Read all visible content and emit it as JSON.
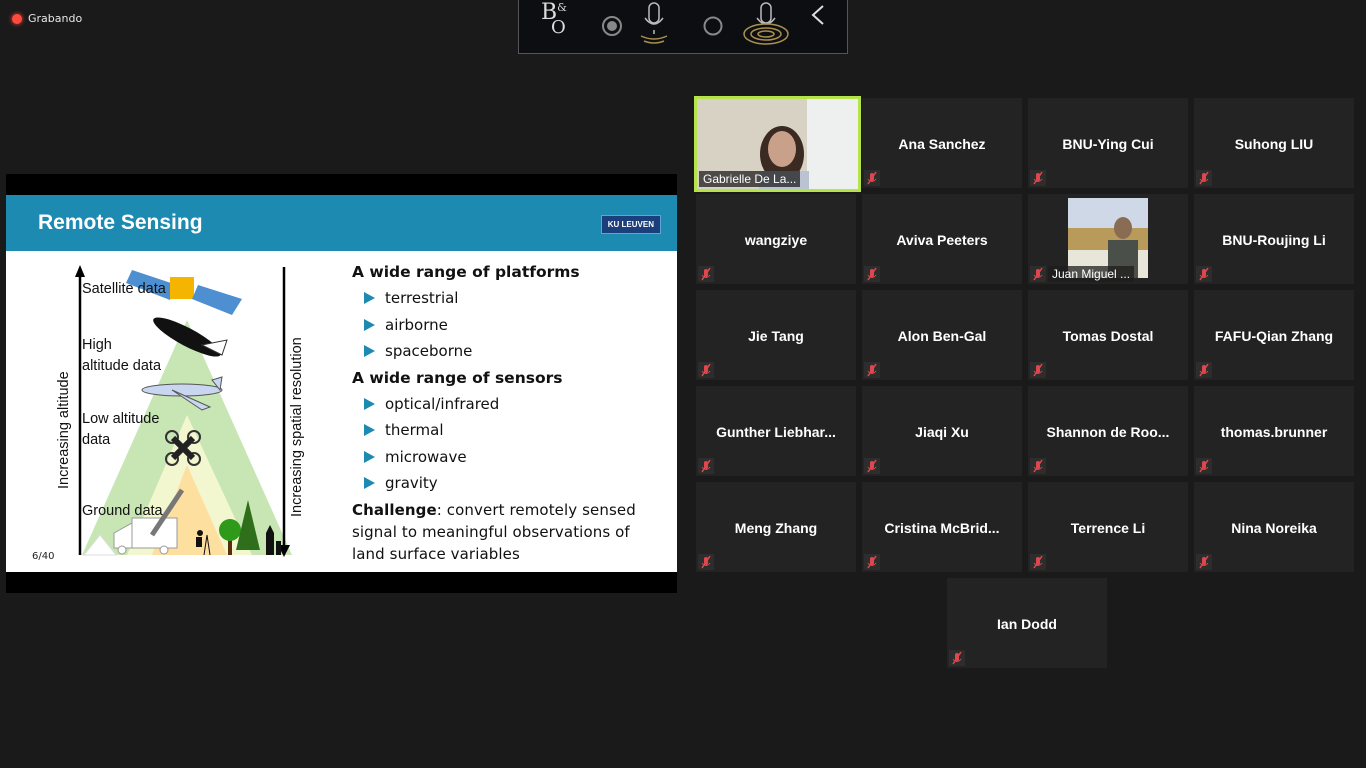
{
  "recording": {
    "label": "Grabando",
    "color": "#ff4a3d"
  },
  "toolbar": {
    "logo_main": "B",
    "logo_amp": "&",
    "logo_o": "O",
    "icons": [
      "record-radio-icon",
      "microphone-waves-icon",
      "radio-off-icon",
      "microphone-rings-icon",
      "chevron-left-icon"
    ]
  },
  "slide": {
    "title": "Remote Sensing",
    "logo": "KU LEUVEN",
    "page": "6/40",
    "accent": "#1d8bb1",
    "sections": [
      {
        "heading": "A wide range of platforms",
        "items": [
          "terrestrial",
          "airborne",
          "spaceborne"
        ]
      },
      {
        "heading": "A wide range of sensors",
        "items": [
          "optical/infrared",
          "thermal",
          "microwave",
          "gravity"
        ]
      }
    ],
    "challenge_bold": "Challenge",
    "challenge_text": ": convert remotely sensed signal to meaningful observations of land surface variables",
    "diagram": {
      "left_axis": "Increasing altitude",
      "right_axis": "Increasing spatial resolution",
      "levels": [
        "Satellite data",
        "High altitude data",
        "Low altitude data",
        "Ground data"
      ]
    }
  },
  "participants": [
    {
      "name": "Gabrielle De La...",
      "video": true,
      "active": true
    },
    {
      "name": "Ana Sanchez",
      "muted": true
    },
    {
      "name": "BNU-Ying Cui",
      "muted": true
    },
    {
      "name": "Suhong LIU",
      "muted": true
    },
    {
      "name": "wangziye",
      "muted": true
    },
    {
      "name": "Aviva Peeters",
      "muted": true
    },
    {
      "name": "Juan Miguel ...",
      "muted": true,
      "photo": true
    },
    {
      "name": "BNU-Roujing Li",
      "muted": true
    },
    {
      "name": "Jie Tang",
      "muted": true
    },
    {
      "name": "Alon Ben-Gal",
      "muted": true
    },
    {
      "name": "Tomas Dostal",
      "muted": true
    },
    {
      "name": "FAFU-Qian Zhang",
      "muted": true
    },
    {
      "name": "Gunther  Liebhar...",
      "muted": true
    },
    {
      "name": "Jiaqi Xu",
      "muted": true
    },
    {
      "name": "Shannon  de  Roo...",
      "muted": true
    },
    {
      "name": "thomas.brunner",
      "muted": true
    },
    {
      "name": "Meng Zhang",
      "muted": true
    },
    {
      "name": "Cristina  McBrid...",
      "muted": true
    },
    {
      "name": "Terrence Li",
      "muted": true
    },
    {
      "name": "Nina Noreika",
      "muted": true
    },
    {
      "name": "Ian Dodd",
      "muted": true
    }
  ]
}
